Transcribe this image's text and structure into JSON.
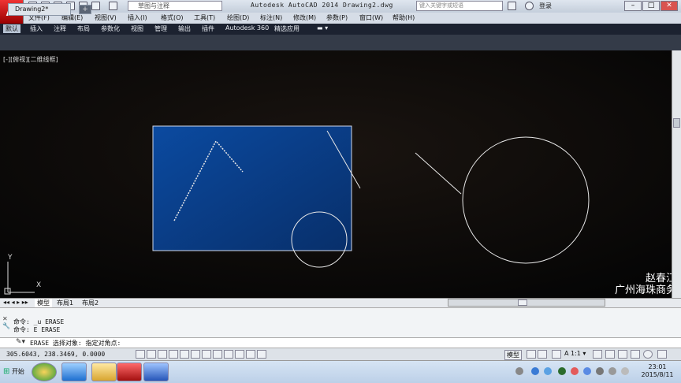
{
  "titlebar": {
    "app_logo": "A",
    "workspace": "草图与注释",
    "title": "Autodesk AutoCAD 2014    Drawing2.dwg",
    "search_placeholder": "键入关键字或短语",
    "login": "登录",
    "min": "–",
    "max": "□",
    "close": "✕"
  },
  "menubar": {
    "items": [
      "文件(F)",
      "编辑(E)",
      "视图(V)",
      "插入(I)",
      "格式(O)",
      "工具(T)",
      "绘图(D)",
      "标注(N)",
      "修改(M)",
      "参数(P)",
      "窗口(W)",
      "帮助(H)"
    ]
  },
  "ribbon": {
    "tabs": [
      "默认",
      "插入",
      "注释",
      "布局",
      "参数化",
      "视图",
      "管理",
      "输出",
      "插件",
      "Autodesk 360",
      "精选应用"
    ]
  },
  "doctab": {
    "label": "Drawing2*",
    "new": "+"
  },
  "viewport": {
    "label": "[-][俯视][二维线框]"
  },
  "ucs": {
    "y": "Y",
    "x": "X"
  },
  "layout_tabs": [
    "模型",
    "布局1",
    "布局2"
  ],
  "watermark": {
    "line1": "赵春江",
    "line2": "广州海珠商务"
  },
  "command": {
    "history": [
      "命令: _u ERASE",
      "命令: E ERASE"
    ],
    "prompt": "ERASE 选择对象: 指定对角点:"
  },
  "status": {
    "coords": "305.6043, 238.3469, 0.0000",
    "model": "模型",
    "scale": "A 1:1 ▾"
  },
  "taskbar": {
    "start": "开始",
    "time": "23:01",
    "date": "2015/8/11"
  },
  "colors": {
    "selection_fill": "#0a3f86",
    "background": "#060606"
  }
}
